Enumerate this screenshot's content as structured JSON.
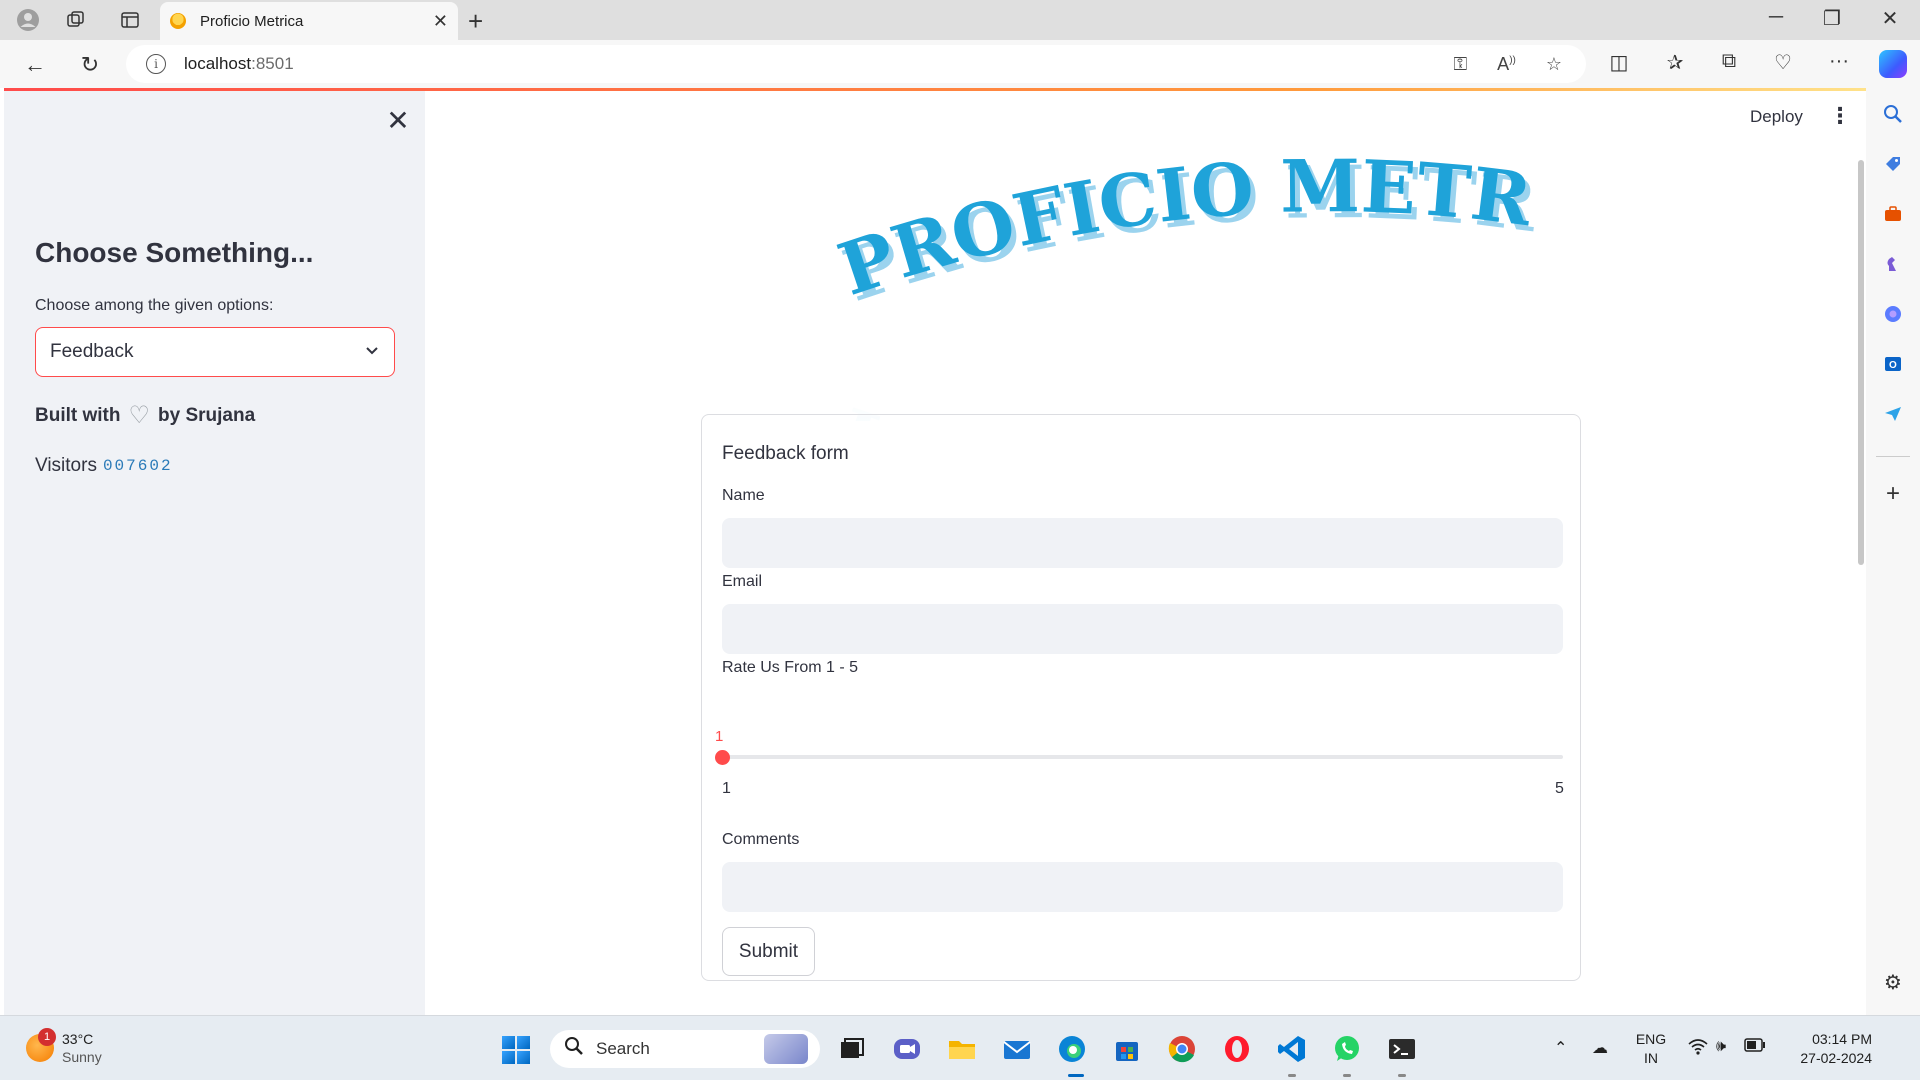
{
  "browser": {
    "tab_title": "Proficio Metrica",
    "url_host": "localhost",
    "url_port": ":8501"
  },
  "sidebar": {
    "title": "Choose Something...",
    "select_label": "Choose among the given options:",
    "selected_option": "Feedback",
    "built_with_prefix": "Built with",
    "built_with_suffix": "by Srujana",
    "visitors_label": "Visitors",
    "visitors_count": "007602"
  },
  "header": {
    "deploy_label": "Deploy"
  },
  "logo": {
    "text": "PROFICIO METRICA",
    "color": "#1fa3d9"
  },
  "form": {
    "title": "Feedback form",
    "name_label": "Name",
    "name_value": "",
    "email_label": "Email",
    "email_value": "",
    "rating_label": "Rate Us From 1 - 5",
    "rating_value": "1",
    "rating_min": "1",
    "rating_max": "5",
    "comments_label": "Comments",
    "comments_value": "",
    "submit_label": "Submit"
  },
  "taskbar": {
    "weather_temp": "33°C",
    "weather_desc": "Sunny",
    "weather_badge": "1",
    "search_placeholder": "Search",
    "lang_top": "ENG",
    "lang_bottom": "IN",
    "time": "03:14 PM",
    "date": "27-02-2024"
  },
  "colors": {
    "accent": "#ff4b4b",
    "sidebar_bg": "#f0f2f6"
  }
}
